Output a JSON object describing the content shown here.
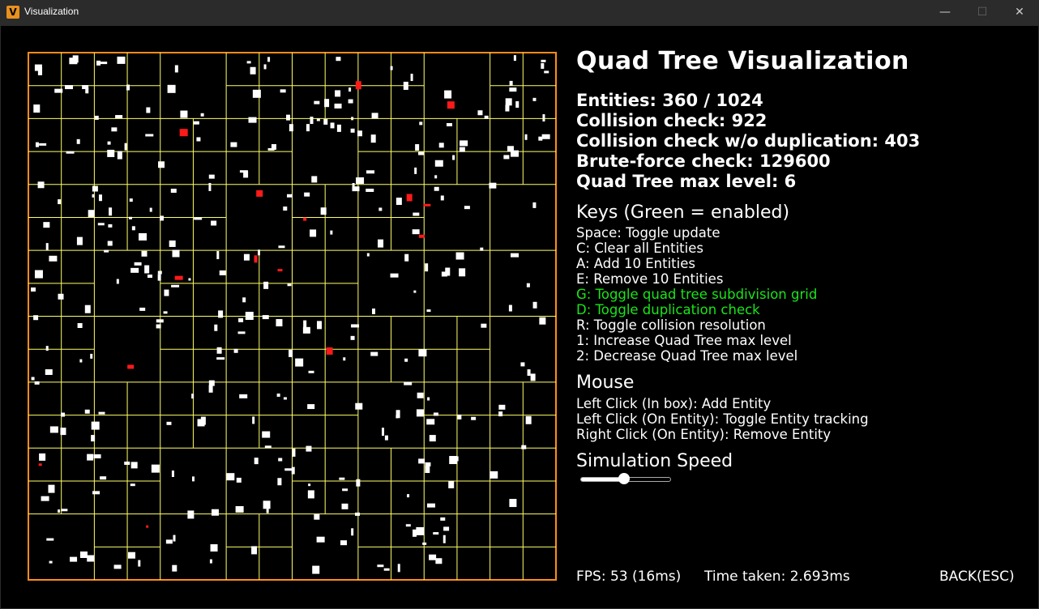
{
  "window": {
    "title": "Visualization",
    "icon": "V",
    "min_glyph": "—",
    "max_glyph": "☐",
    "close_glyph": "✕"
  },
  "title": "Quad Tree Visualization",
  "stats": {
    "entities": "Entities: 360 / 1024",
    "collision_check": "Collision check: 922",
    "collision_no_dup": "Collision check w/o duplication: 403",
    "brute_force": "Brute-force check: 129600",
    "max_level": "Quad Tree max level: 6"
  },
  "keys": {
    "heading": "Keys (Green = enabled)",
    "items": [
      {
        "label": "Space: Toggle update",
        "enabled": false
      },
      {
        "label": "C: Clear all Entities",
        "enabled": false
      },
      {
        "label": "A: Add 10 Entities",
        "enabled": false
      },
      {
        "label": "E: Remove 10 Entities",
        "enabled": false
      },
      {
        "label": "G: Toggle quad tree subdivision grid",
        "enabled": true
      },
      {
        "label": "D: Toggle duplication check",
        "enabled": true
      },
      {
        "label": "R: Toggle collision resolution",
        "enabled": false
      },
      {
        "label": "1: Increase Quad Tree max level",
        "enabled": false
      },
      {
        "label": "2: Decrease Quad Tree max level",
        "enabled": false
      }
    ]
  },
  "mouse": {
    "heading": "Mouse",
    "items": [
      "Left Click (In box): Add Entity",
      "Left Click (On Entity): Toggle Entity tracking",
      "Right Click (On Entity): Remove Entity"
    ]
  },
  "speed": {
    "heading": "Simulation Speed",
    "value": 0.5
  },
  "footer": {
    "fps": "FPS: 53 (16ms)",
    "time": "Time taken: 2.693ms",
    "back": "BACK(ESC)"
  },
  "colors": {
    "border": "#ff8c1a",
    "grid": "#ffff66",
    "entity": "#ffffff",
    "colliding": "#ff1a1a",
    "enabled": "#19e619"
  }
}
